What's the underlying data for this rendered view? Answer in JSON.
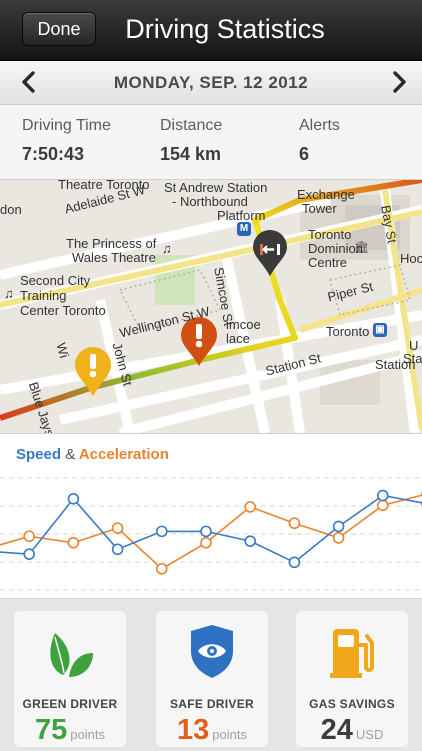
{
  "header": {
    "done_label": "Done",
    "title": "Driving Statistics"
  },
  "date_nav": {
    "date": "MONDAY, SEP. 12 2012",
    "prev_icon": "chevron-left-icon",
    "next_icon": "chevron-right-icon"
  },
  "stats": [
    {
      "label": "Driving Time",
      "value": "7:50:43"
    },
    {
      "label": "Distance",
      "value": "154 km"
    },
    {
      "label": "Alerts",
      "value": "6"
    }
  ],
  "map": {
    "labels": [
      {
        "text": "Theatre Toronto"
      },
      {
        "text": "St Andrew Station"
      },
      {
        "text": "- Northbound"
      },
      {
        "text": "Platform"
      },
      {
        "text": "Exchange"
      },
      {
        "text": "Tower"
      },
      {
        "text": "Adelaide St W"
      },
      {
        "text": "don"
      },
      {
        "text": "The Princess of"
      },
      {
        "text": "Wales Theatre"
      },
      {
        "text": "Toronto"
      },
      {
        "text": "Dominion"
      },
      {
        "text": "Centre"
      },
      {
        "text": "Bay St"
      },
      {
        "text": "Hoo"
      },
      {
        "text": "Second City"
      },
      {
        "text": "Training"
      },
      {
        "text": "Center Toronto"
      },
      {
        "text": "Simcoe St"
      },
      {
        "text": "Wellington St W"
      },
      {
        "text": "imcoe"
      },
      {
        "text": "lace"
      },
      {
        "text": "Piper St"
      },
      {
        "text": "Toronto"
      },
      {
        "text": "Wi"
      },
      {
        "text": "John St"
      },
      {
        "text": "Station St"
      },
      {
        "text": "Blue Jays"
      },
      {
        "text": "U"
      },
      {
        "text": "Stat"
      },
      {
        "text": "Station"
      }
    ]
  },
  "chart_data": {
    "type": "line",
    "legend": [
      {
        "name": "Speed",
        "color": "#3a7ac4"
      },
      {
        "name": "Acceleration",
        "color": "#e8832f"
      }
    ],
    "amp": "&",
    "x": [
      0,
      1,
      2,
      3,
      4,
      5,
      6,
      7,
      8,
      9,
      10
    ],
    "series": [
      {
        "name": "Speed",
        "color": "#3a7ac4",
        "values": [
          54,
          52,
          86,
          55,
          66,
          66,
          60,
          47,
          69,
          88,
          83
        ]
      },
      {
        "name": "Acceleration",
        "color": "#e8832f",
        "values": [
          55,
          63,
          59,
          68,
          43,
          59,
          81,
          71,
          62,
          82,
          89
        ]
      }
    ],
    "ylim": [
      30,
      100
    ],
    "grid": true
  },
  "cards": [
    {
      "label": "GREEN DRIVER",
      "value": "75",
      "unit": "points",
      "color": "#3fa23f",
      "icon": "leaf-icon"
    },
    {
      "label": "SAFE DRIVER",
      "value": "13",
      "unit": "points",
      "color": "#e0601a",
      "icon": "shield-eye-icon"
    },
    {
      "label": "GAS SAVINGS",
      "value": "24",
      "unit": "USD",
      "color": "#3c3c3c",
      "icon": "gas-pump-icon"
    }
  ]
}
